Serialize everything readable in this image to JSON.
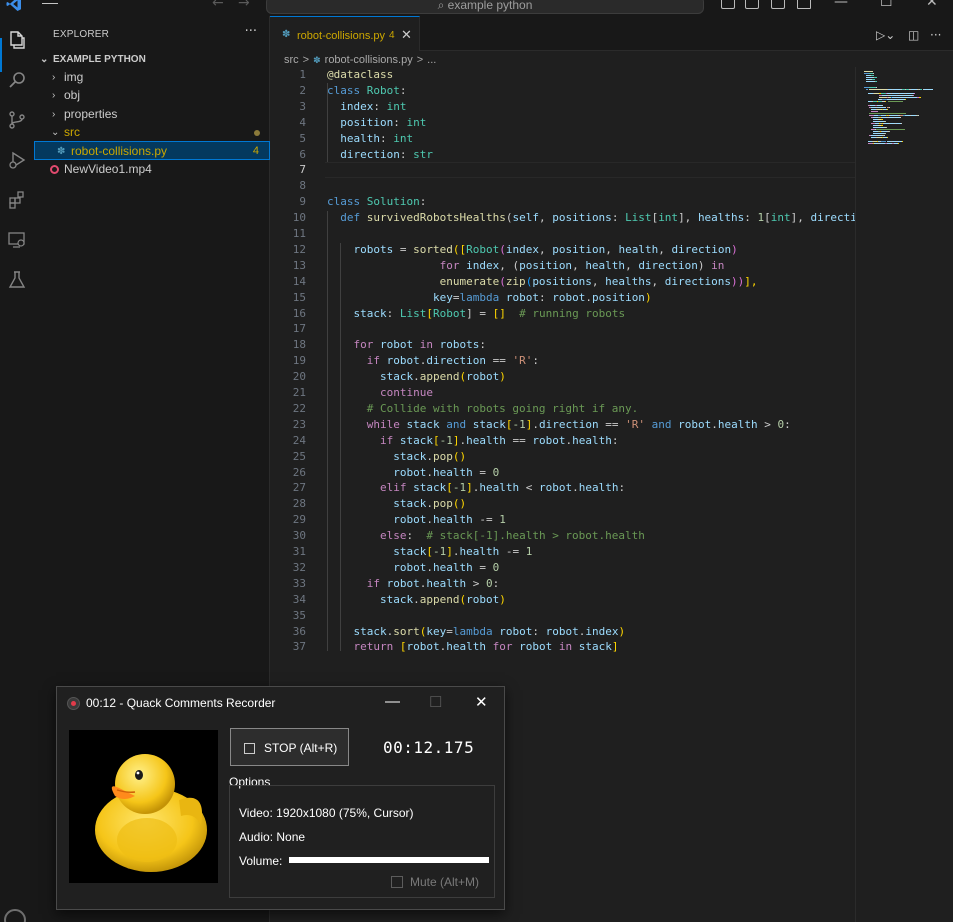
{
  "window": {
    "command_center": "example python"
  },
  "explorer": {
    "title": "EXPLORER",
    "more": "···",
    "project": "EXAMPLE PYTHON",
    "items": [
      {
        "label": "img",
        "type": "folder",
        "expanded": false
      },
      {
        "label": "obj",
        "type": "folder",
        "expanded": false
      },
      {
        "label": "properties",
        "type": "folder",
        "expanded": false
      },
      {
        "label": "src",
        "type": "folder",
        "expanded": true,
        "modified": true
      },
      {
        "label": "robot-collisions.py",
        "type": "python-file",
        "selected": true,
        "problems": "4"
      },
      {
        "label": "NewVideo1.mp4",
        "type": "video-file"
      }
    ]
  },
  "editor": {
    "tab": {
      "label": "robot-collisions.py",
      "problems": "4"
    },
    "breadcrumb": [
      "src",
      ">",
      "robot-collisions.py",
      ">",
      "..."
    ],
    "current_line": 7,
    "lines": [
      [
        [
          "@dataclass",
          "#dcdcaa"
        ]
      ],
      [
        [
          "class ",
          "#569cd6"
        ],
        [
          "Robot",
          "#4ec9b0"
        ],
        [
          ":",
          "#cccccc"
        ]
      ],
      [
        [
          "  index",
          "#9cdcfe"
        ],
        [
          ": ",
          "#cccccc"
        ],
        [
          "int",
          "#4ec9b0"
        ]
      ],
      [
        [
          "  position",
          "#9cdcfe"
        ],
        [
          ": ",
          "#cccccc"
        ],
        [
          "int",
          "#4ec9b0"
        ]
      ],
      [
        [
          "  health",
          "#9cdcfe"
        ],
        [
          ": ",
          "#cccccc"
        ],
        [
          "int",
          "#4ec9b0"
        ]
      ],
      [
        [
          "  direction",
          "#9cdcfe"
        ],
        [
          ": ",
          "#cccccc"
        ],
        [
          "str",
          "#4ec9b0"
        ]
      ],
      [],
      [],
      [
        [
          "class ",
          "#569cd6"
        ],
        [
          "Solution",
          "#4ec9b0"
        ],
        [
          ":",
          "#cccccc"
        ]
      ],
      [
        [
          "  def ",
          "#569cd6"
        ],
        [
          "survivedRobotsHealths",
          "#dcdcaa"
        ],
        [
          "(",
          "#cccccc"
        ],
        [
          "self",
          "#9cdcfe"
        ],
        [
          ", ",
          "#cccccc"
        ],
        [
          "positions",
          "#9cdcfe"
        ],
        [
          ": ",
          "#cccccc"
        ],
        [
          "List",
          "#4ec9b0"
        ],
        [
          "[",
          "#cccccc"
        ],
        [
          "int",
          "#4ec9b0"
        ],
        [
          "], ",
          "#cccccc"
        ],
        [
          "healths",
          "#9cdcfe"
        ],
        [
          ": ",
          "#cccccc"
        ],
        [
          "1",
          "#b5cea8"
        ],
        [
          "[",
          "#cccccc"
        ],
        [
          "int",
          "#4ec9b0"
        ],
        [
          "], ",
          "#cccccc"
        ],
        [
          "directions",
          "#9cdcfe"
        ]
      ],
      [],
      [
        [
          "    robots ",
          "#9cdcfe"
        ],
        [
          "= ",
          "#cccccc"
        ],
        [
          "sorted",
          "#dcdcaa"
        ],
        [
          "([",
          "#ffd700"
        ],
        [
          "Robot",
          "#4ec9b0"
        ],
        [
          "(",
          "#da70d6"
        ],
        [
          "index",
          "#9cdcfe"
        ],
        [
          ", ",
          "#cccccc"
        ],
        [
          "position",
          "#9cdcfe"
        ],
        [
          ", ",
          "#cccccc"
        ],
        [
          "health",
          "#9cdcfe"
        ],
        [
          ", ",
          "#cccccc"
        ],
        [
          "direction",
          "#9cdcfe"
        ],
        [
          ")",
          "#da70d6"
        ]
      ],
      [
        [
          "                 for ",
          "#c586c0"
        ],
        [
          "index",
          "#9cdcfe"
        ],
        [
          ", (",
          "#cccccc"
        ],
        [
          "position",
          "#9cdcfe"
        ],
        [
          ", ",
          "#cccccc"
        ],
        [
          "health",
          "#9cdcfe"
        ],
        [
          ", ",
          "#cccccc"
        ],
        [
          "direction",
          "#9cdcfe"
        ],
        [
          ") ",
          "#cccccc"
        ],
        [
          "in",
          "#c586c0"
        ]
      ],
      [
        [
          "                 enumerate",
          "#dcdcaa"
        ],
        [
          "(",
          "#da70d6"
        ],
        [
          "zip",
          "#dcdcaa"
        ],
        [
          "(",
          "#179fff"
        ],
        [
          "positions",
          "#9cdcfe"
        ],
        [
          ", ",
          "#cccccc"
        ],
        [
          "healths",
          "#9cdcfe"
        ],
        [
          ", ",
          "#cccccc"
        ],
        [
          "directions",
          "#9cdcfe"
        ],
        [
          "))",
          "#da70d6"
        ],
        [
          "],",
          "#ffd700"
        ]
      ],
      [
        [
          "                key",
          "#9cdcfe"
        ],
        [
          "=",
          "#cccccc"
        ],
        [
          "lambda ",
          "#569cd6"
        ],
        [
          "robot",
          "#9cdcfe"
        ],
        [
          ": ",
          "#cccccc"
        ],
        [
          "robot",
          "#9cdcfe"
        ],
        [
          ".",
          "#cccccc"
        ],
        [
          "position",
          "#9cdcfe"
        ],
        [
          ")",
          "#ffd700"
        ]
      ],
      [
        [
          "    stack",
          "#9cdcfe"
        ],
        [
          ": ",
          "#cccccc"
        ],
        [
          "List",
          "#4ec9b0"
        ],
        [
          "[",
          "#ffd700"
        ],
        [
          "Robot",
          "#4ec9b0"
        ],
        [
          "] = ",
          "#cccccc"
        ],
        [
          "[]",
          "#ffd700"
        ],
        [
          "  # running robots",
          "#6a9955"
        ]
      ],
      [],
      [
        [
          "    for ",
          "#c586c0"
        ],
        [
          "robot ",
          "#9cdcfe"
        ],
        [
          "in ",
          "#c586c0"
        ],
        [
          "robots",
          "#9cdcfe"
        ],
        [
          ":",
          "#cccccc"
        ]
      ],
      [
        [
          "      if ",
          "#c586c0"
        ],
        [
          "robot",
          "#9cdcfe"
        ],
        [
          ".",
          "#cccccc"
        ],
        [
          "direction ",
          "#9cdcfe"
        ],
        [
          "== ",
          "#cccccc"
        ],
        [
          "'R'",
          "#ce9178"
        ],
        [
          ":",
          "#cccccc"
        ]
      ],
      [
        [
          "        stack",
          "#9cdcfe"
        ],
        [
          ".",
          "#cccccc"
        ],
        [
          "append",
          "#dcdcaa"
        ],
        [
          "(",
          "#ffd700"
        ],
        [
          "robot",
          "#9cdcfe"
        ],
        [
          ")",
          "#ffd700"
        ]
      ],
      [
        [
          "        continue",
          "#c586c0"
        ]
      ],
      [
        [
          "      # Collide with robots going right if any.",
          "#6a9955"
        ]
      ],
      [
        [
          "      while ",
          "#c586c0"
        ],
        [
          "stack ",
          "#9cdcfe"
        ],
        [
          "and ",
          "#569cd6"
        ],
        [
          "stack",
          "#9cdcfe"
        ],
        [
          "[",
          "#ffd700"
        ],
        [
          "-1",
          "#b5cea8"
        ],
        [
          "]",
          "#ffd700"
        ],
        [
          ".",
          "#cccccc"
        ],
        [
          "direction ",
          "#9cdcfe"
        ],
        [
          "== ",
          "#cccccc"
        ],
        [
          "'R' ",
          "#ce9178"
        ],
        [
          "and ",
          "#569cd6"
        ],
        [
          "robot",
          "#9cdcfe"
        ],
        [
          ".",
          "#cccccc"
        ],
        [
          "health ",
          "#9cdcfe"
        ],
        [
          "> ",
          "#cccccc"
        ],
        [
          "0",
          "#b5cea8"
        ],
        [
          ":",
          "#cccccc"
        ]
      ],
      [
        [
          "        if ",
          "#c586c0"
        ],
        [
          "stack",
          "#9cdcfe"
        ],
        [
          "[",
          "#ffd700"
        ],
        [
          "-1",
          "#b5cea8"
        ],
        [
          "]",
          "#ffd700"
        ],
        [
          ".",
          "#cccccc"
        ],
        [
          "health ",
          "#9cdcfe"
        ],
        [
          "== ",
          "#cccccc"
        ],
        [
          "robot",
          "#9cdcfe"
        ],
        [
          ".",
          "#cccccc"
        ],
        [
          "health",
          "#9cdcfe"
        ],
        [
          ":",
          "#cccccc"
        ]
      ],
      [
        [
          "          stack",
          "#9cdcfe"
        ],
        [
          ".",
          "#cccccc"
        ],
        [
          "pop",
          "#dcdcaa"
        ],
        [
          "()",
          "#ffd700"
        ]
      ],
      [
        [
          "          robot",
          "#9cdcfe"
        ],
        [
          ".",
          "#cccccc"
        ],
        [
          "health ",
          "#9cdcfe"
        ],
        [
          "= ",
          "#cccccc"
        ],
        [
          "0",
          "#b5cea8"
        ]
      ],
      [
        [
          "        elif ",
          "#c586c0"
        ],
        [
          "stack",
          "#9cdcfe"
        ],
        [
          "[",
          "#ffd700"
        ],
        [
          "-1",
          "#b5cea8"
        ],
        [
          "]",
          "#ffd700"
        ],
        [
          ".",
          "#cccccc"
        ],
        [
          "health ",
          "#9cdcfe"
        ],
        [
          "< ",
          "#cccccc"
        ],
        [
          "robot",
          "#9cdcfe"
        ],
        [
          ".",
          "#cccccc"
        ],
        [
          "health",
          "#9cdcfe"
        ],
        [
          ":",
          "#cccccc"
        ]
      ],
      [
        [
          "          stack",
          "#9cdcfe"
        ],
        [
          ".",
          "#cccccc"
        ],
        [
          "pop",
          "#dcdcaa"
        ],
        [
          "()",
          "#ffd700"
        ]
      ],
      [
        [
          "          robot",
          "#9cdcfe"
        ],
        [
          ".",
          "#cccccc"
        ],
        [
          "health ",
          "#9cdcfe"
        ],
        [
          "-= ",
          "#cccccc"
        ],
        [
          "1",
          "#b5cea8"
        ]
      ],
      [
        [
          "        else",
          "#c586c0"
        ],
        [
          ":  ",
          "#cccccc"
        ],
        [
          "# stack[-1].health > robot.health",
          "#6a9955"
        ]
      ],
      [
        [
          "          stack",
          "#9cdcfe"
        ],
        [
          "[",
          "#ffd700"
        ],
        [
          "-1",
          "#b5cea8"
        ],
        [
          "]",
          "#ffd700"
        ],
        [
          ".",
          "#cccccc"
        ],
        [
          "health ",
          "#9cdcfe"
        ],
        [
          "-= ",
          "#cccccc"
        ],
        [
          "1",
          "#b5cea8"
        ]
      ],
      [
        [
          "          robot",
          "#9cdcfe"
        ],
        [
          ".",
          "#cccccc"
        ],
        [
          "health ",
          "#9cdcfe"
        ],
        [
          "= ",
          "#cccccc"
        ],
        [
          "0",
          "#b5cea8"
        ]
      ],
      [
        [
          "      if ",
          "#c586c0"
        ],
        [
          "robot",
          "#9cdcfe"
        ],
        [
          ".",
          "#cccccc"
        ],
        [
          "health ",
          "#9cdcfe"
        ],
        [
          "> ",
          "#cccccc"
        ],
        [
          "0",
          "#b5cea8"
        ],
        [
          ":",
          "#cccccc"
        ]
      ],
      [
        [
          "        stack",
          "#9cdcfe"
        ],
        [
          ".",
          "#cccccc"
        ],
        [
          "append",
          "#dcdcaa"
        ],
        [
          "(",
          "#ffd700"
        ],
        [
          "robot",
          "#9cdcfe"
        ],
        [
          ")",
          "#ffd700"
        ]
      ],
      [],
      [
        [
          "    stack",
          "#9cdcfe"
        ],
        [
          ".",
          "#cccccc"
        ],
        [
          "sort",
          "#dcdcaa"
        ],
        [
          "(",
          "#ffd700"
        ],
        [
          "key",
          "#9cdcfe"
        ],
        [
          "=",
          "#cccccc"
        ],
        [
          "lambda ",
          "#569cd6"
        ],
        [
          "robot",
          "#9cdcfe"
        ],
        [
          ": ",
          "#cccccc"
        ],
        [
          "robot",
          "#9cdcfe"
        ],
        [
          ".",
          "#cccccc"
        ],
        [
          "index",
          "#9cdcfe"
        ],
        [
          ")",
          "#ffd700"
        ]
      ],
      [
        [
          "    return ",
          "#c586c0"
        ],
        [
          "[",
          "#ffd700"
        ],
        [
          "robot",
          "#9cdcfe"
        ],
        [
          ".",
          "#cccccc"
        ],
        [
          "health ",
          "#9cdcfe"
        ],
        [
          "for ",
          "#c586c0"
        ],
        [
          "robot ",
          "#9cdcfe"
        ],
        [
          "in ",
          "#c586c0"
        ],
        [
          "stack",
          "#9cdcfe"
        ],
        [
          "]",
          "#ffd700"
        ]
      ]
    ]
  },
  "recorder": {
    "title": "00:12 - Quack Comments Recorder",
    "stop_label": "STOP (Alt+R)",
    "timer": "00:12.175",
    "options_label": "Options",
    "video": "Video: 1920x1080 (75%, Cursor)",
    "audio": "Audio: None",
    "volume_label": "Volume:",
    "volume_level": 1.0,
    "mute_label": "Mute (Alt+M)",
    "mute_checked": false
  },
  "colors": {
    "accent": "#0078d4",
    "warning": "#cca700",
    "python": "#519aba",
    "video": "#e14a6e",
    "duck": "#f5c518"
  }
}
